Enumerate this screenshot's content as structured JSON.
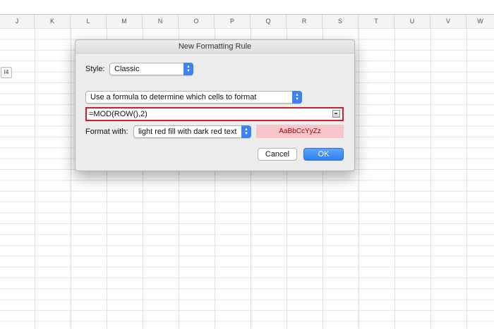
{
  "columns": [
    "J",
    "K",
    "L",
    "M",
    "N",
    "O",
    "P",
    "Q",
    "R",
    "S",
    "T",
    "U",
    "V",
    "W"
  ],
  "cell_reference": "I4",
  "dialog": {
    "title": "New Formatting Rule",
    "style_label": "Style:",
    "style_value": "Classic",
    "rule_type": "Use a formula to determine which cells to format",
    "formula": "=MOD(ROW(),2)",
    "format_label": "Format with:",
    "format_value": "light red fill with dark red text",
    "preview_text": "AaBbCcYyZz",
    "cancel_label": "Cancel",
    "ok_label": "OK"
  },
  "colors": {
    "highlight_border": "#d11c2a",
    "preview_fill": "#f8c5ca",
    "preview_text": "#9c0006",
    "accent_blue": "#3d82f0"
  }
}
